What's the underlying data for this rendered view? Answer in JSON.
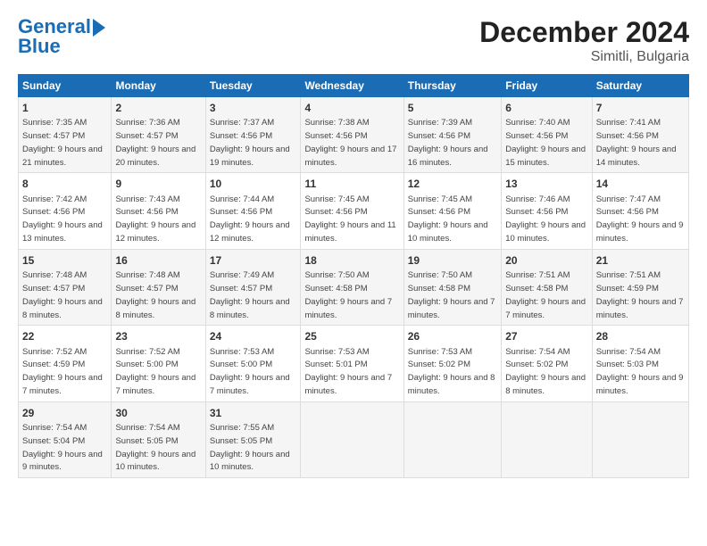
{
  "logo": {
    "line1": "General",
    "line2": "Blue"
  },
  "title": "December 2024",
  "subtitle": "Simitli, Bulgaria",
  "days_of_week": [
    "Sunday",
    "Monday",
    "Tuesday",
    "Wednesday",
    "Thursday",
    "Friday",
    "Saturday"
  ],
  "weeks": [
    [
      {
        "day": 1,
        "sunrise": "7:35 AM",
        "sunset": "4:57 PM",
        "daylight": "9 hours and 21 minutes."
      },
      {
        "day": 2,
        "sunrise": "7:36 AM",
        "sunset": "4:57 PM",
        "daylight": "9 hours and 20 minutes."
      },
      {
        "day": 3,
        "sunrise": "7:37 AM",
        "sunset": "4:56 PM",
        "daylight": "9 hours and 19 minutes."
      },
      {
        "day": 4,
        "sunrise": "7:38 AM",
        "sunset": "4:56 PM",
        "daylight": "9 hours and 17 minutes."
      },
      {
        "day": 5,
        "sunrise": "7:39 AM",
        "sunset": "4:56 PM",
        "daylight": "9 hours and 16 minutes."
      },
      {
        "day": 6,
        "sunrise": "7:40 AM",
        "sunset": "4:56 PM",
        "daylight": "9 hours and 15 minutes."
      },
      {
        "day": 7,
        "sunrise": "7:41 AM",
        "sunset": "4:56 PM",
        "daylight": "9 hours and 14 minutes."
      }
    ],
    [
      {
        "day": 8,
        "sunrise": "7:42 AM",
        "sunset": "4:56 PM",
        "daylight": "9 hours and 13 minutes."
      },
      {
        "day": 9,
        "sunrise": "7:43 AM",
        "sunset": "4:56 PM",
        "daylight": "9 hours and 12 minutes."
      },
      {
        "day": 10,
        "sunrise": "7:44 AM",
        "sunset": "4:56 PM",
        "daylight": "9 hours and 12 minutes."
      },
      {
        "day": 11,
        "sunrise": "7:45 AM",
        "sunset": "4:56 PM",
        "daylight": "9 hours and 11 minutes."
      },
      {
        "day": 12,
        "sunrise": "7:45 AM",
        "sunset": "4:56 PM",
        "daylight": "9 hours and 10 minutes."
      },
      {
        "day": 13,
        "sunrise": "7:46 AM",
        "sunset": "4:56 PM",
        "daylight": "9 hours and 10 minutes."
      },
      {
        "day": 14,
        "sunrise": "7:47 AM",
        "sunset": "4:56 PM",
        "daylight": "9 hours and 9 minutes."
      }
    ],
    [
      {
        "day": 15,
        "sunrise": "7:48 AM",
        "sunset": "4:57 PM",
        "daylight": "9 hours and 8 minutes."
      },
      {
        "day": 16,
        "sunrise": "7:48 AM",
        "sunset": "4:57 PM",
        "daylight": "9 hours and 8 minutes."
      },
      {
        "day": 17,
        "sunrise": "7:49 AM",
        "sunset": "4:57 PM",
        "daylight": "9 hours and 8 minutes."
      },
      {
        "day": 18,
        "sunrise": "7:50 AM",
        "sunset": "4:58 PM",
        "daylight": "9 hours and 7 minutes."
      },
      {
        "day": 19,
        "sunrise": "7:50 AM",
        "sunset": "4:58 PM",
        "daylight": "9 hours and 7 minutes."
      },
      {
        "day": 20,
        "sunrise": "7:51 AM",
        "sunset": "4:58 PM",
        "daylight": "9 hours and 7 minutes."
      },
      {
        "day": 21,
        "sunrise": "7:51 AM",
        "sunset": "4:59 PM",
        "daylight": "9 hours and 7 minutes."
      }
    ],
    [
      {
        "day": 22,
        "sunrise": "7:52 AM",
        "sunset": "4:59 PM",
        "daylight": "9 hours and 7 minutes."
      },
      {
        "day": 23,
        "sunrise": "7:52 AM",
        "sunset": "5:00 PM",
        "daylight": "9 hours and 7 minutes."
      },
      {
        "day": 24,
        "sunrise": "7:53 AM",
        "sunset": "5:00 PM",
        "daylight": "9 hours and 7 minutes."
      },
      {
        "day": 25,
        "sunrise": "7:53 AM",
        "sunset": "5:01 PM",
        "daylight": "9 hours and 7 minutes."
      },
      {
        "day": 26,
        "sunrise": "7:53 AM",
        "sunset": "5:02 PM",
        "daylight": "9 hours and 8 minutes."
      },
      {
        "day": 27,
        "sunrise": "7:54 AM",
        "sunset": "5:02 PM",
        "daylight": "9 hours and 8 minutes."
      },
      {
        "day": 28,
        "sunrise": "7:54 AM",
        "sunset": "5:03 PM",
        "daylight": "9 hours and 9 minutes."
      }
    ],
    [
      {
        "day": 29,
        "sunrise": "7:54 AM",
        "sunset": "5:04 PM",
        "daylight": "9 hours and 9 minutes."
      },
      {
        "day": 30,
        "sunrise": "7:54 AM",
        "sunset": "5:05 PM",
        "daylight": "9 hours and 10 minutes."
      },
      {
        "day": 31,
        "sunrise": "7:55 AM",
        "sunset": "5:05 PM",
        "daylight": "9 hours and 10 minutes."
      },
      null,
      null,
      null,
      null
    ]
  ]
}
